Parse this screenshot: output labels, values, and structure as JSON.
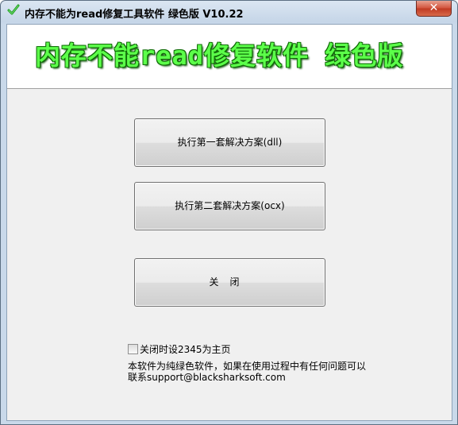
{
  "window": {
    "title": "内存不能为read修复工具软件 绿色版 V10.22",
    "close_label": "✕",
    "icon": "green-checkmark-icon"
  },
  "banner": {
    "text": "内存不能read修复软件 绿色版"
  },
  "buttons": {
    "solution1": "执行第一套解决方案(dll)",
    "solution2": "执行第二套解决方案(ocx)",
    "close": "关闭"
  },
  "checkbox": {
    "label": "关闭时设2345为主页",
    "checked": false
  },
  "info": {
    "line1": "本软件为纯绿色软件，如果在使用过程中有任何问题可以",
    "line2": "联系support@blacksharksoft.com"
  },
  "colors": {
    "banner_text": "#5cff4a",
    "banner_outline": "#116b08"
  }
}
